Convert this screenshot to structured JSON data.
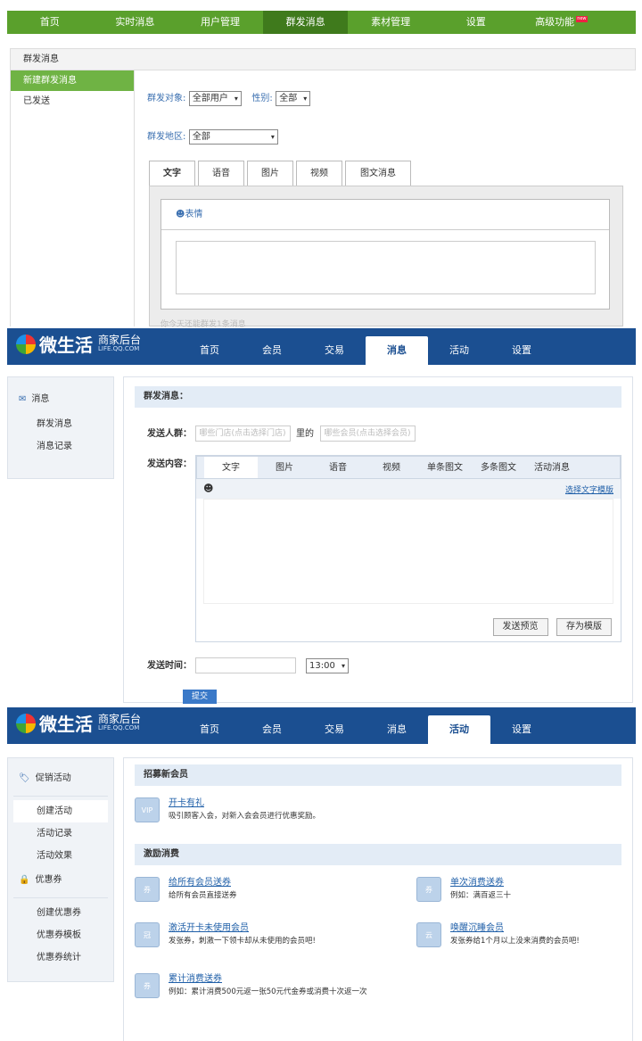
{
  "panel1": {
    "nav": [
      {
        "label": "首页"
      },
      {
        "label": "实时消息"
      },
      {
        "label": "用户管理"
      },
      {
        "label": "群发消息"
      },
      {
        "label": "素材管理"
      },
      {
        "label": "设置"
      },
      {
        "label": "高级功能"
      }
    ],
    "nav_new_badge": "new",
    "page_title": "群发消息",
    "side_items": [
      "新建群发消息",
      "已发送"
    ],
    "target_label": "群发对象:",
    "target_value": "全部用户",
    "gender_label": "性别:",
    "gender_value": "全部",
    "region_label": "群发地区:",
    "region_value": "全部",
    "tabs": [
      "文字",
      "语音",
      "图片",
      "视频",
      "图文消息"
    ],
    "emoji_label": "表情",
    "hint": "你今天还能群发1条消息"
  },
  "brand": {
    "name": "微生活",
    "sub": "商家后台",
    "url": "LIFE.QQ.COM"
  },
  "panel2": {
    "nav": [
      "首页",
      "会员",
      "交易",
      "消息",
      "活动",
      "设置"
    ],
    "side_title": "消息",
    "side_items": [
      "群发消息",
      "消息记录"
    ],
    "section_title": "群发消息：",
    "audience_label": "发送人群：",
    "store_placeholder": "哪些门店(点击选择门店)",
    "of_text": "里的",
    "member_placeholder": "哪些会员(点击选择会员)",
    "content_label": "发送内容：",
    "tabs": [
      "文字",
      "图片",
      "语音",
      "视频",
      "单条图文",
      "多条图文",
      "活动消息"
    ],
    "template_link": "选择文字模版",
    "preview_button": "发送预览",
    "save_template_button": "存为模版",
    "time_label": "发送时间：",
    "time_value": "13:00",
    "submit": "提交"
  },
  "panel3": {
    "nav": [
      "首页",
      "会员",
      "交易",
      "消息",
      "活动",
      "设置"
    ],
    "side_group1": "促销活动",
    "side_items1": [
      "创建活动",
      "活动记录",
      "活动效果"
    ],
    "side_group2": "优惠券",
    "side_items2": [
      "创建优惠券",
      "优惠券模板",
      "优惠券统计"
    ],
    "section1": "招募新会员",
    "recruit": {
      "title": "开卡有礼",
      "desc": "吸引顾客入会，对新入会会员进行优惠奖励。",
      "icon": "VIP"
    },
    "section2": "激励消费",
    "items": [
      {
        "title": "给所有会员送券",
        "desc": "给所有会员直接送券",
        "icon": "券"
      },
      {
        "title": "单次消费送券",
        "desc": "例如：满百返三十",
        "icon": "券"
      },
      {
        "title": "激活开卡未使用会员",
        "desc": "发张券，刺激一下领卡却从未使用的会员吧!",
        "icon": "冠"
      },
      {
        "title": "唤醒沉睡会员",
        "desc": "发张券给1个月以上没来消费的会员吧!",
        "icon": "云"
      },
      {
        "title": "累计消费送券",
        "desc": "例如：累计消费500元返一张50元代金券或消费十次返一次",
        "icon": "券"
      }
    ]
  }
}
